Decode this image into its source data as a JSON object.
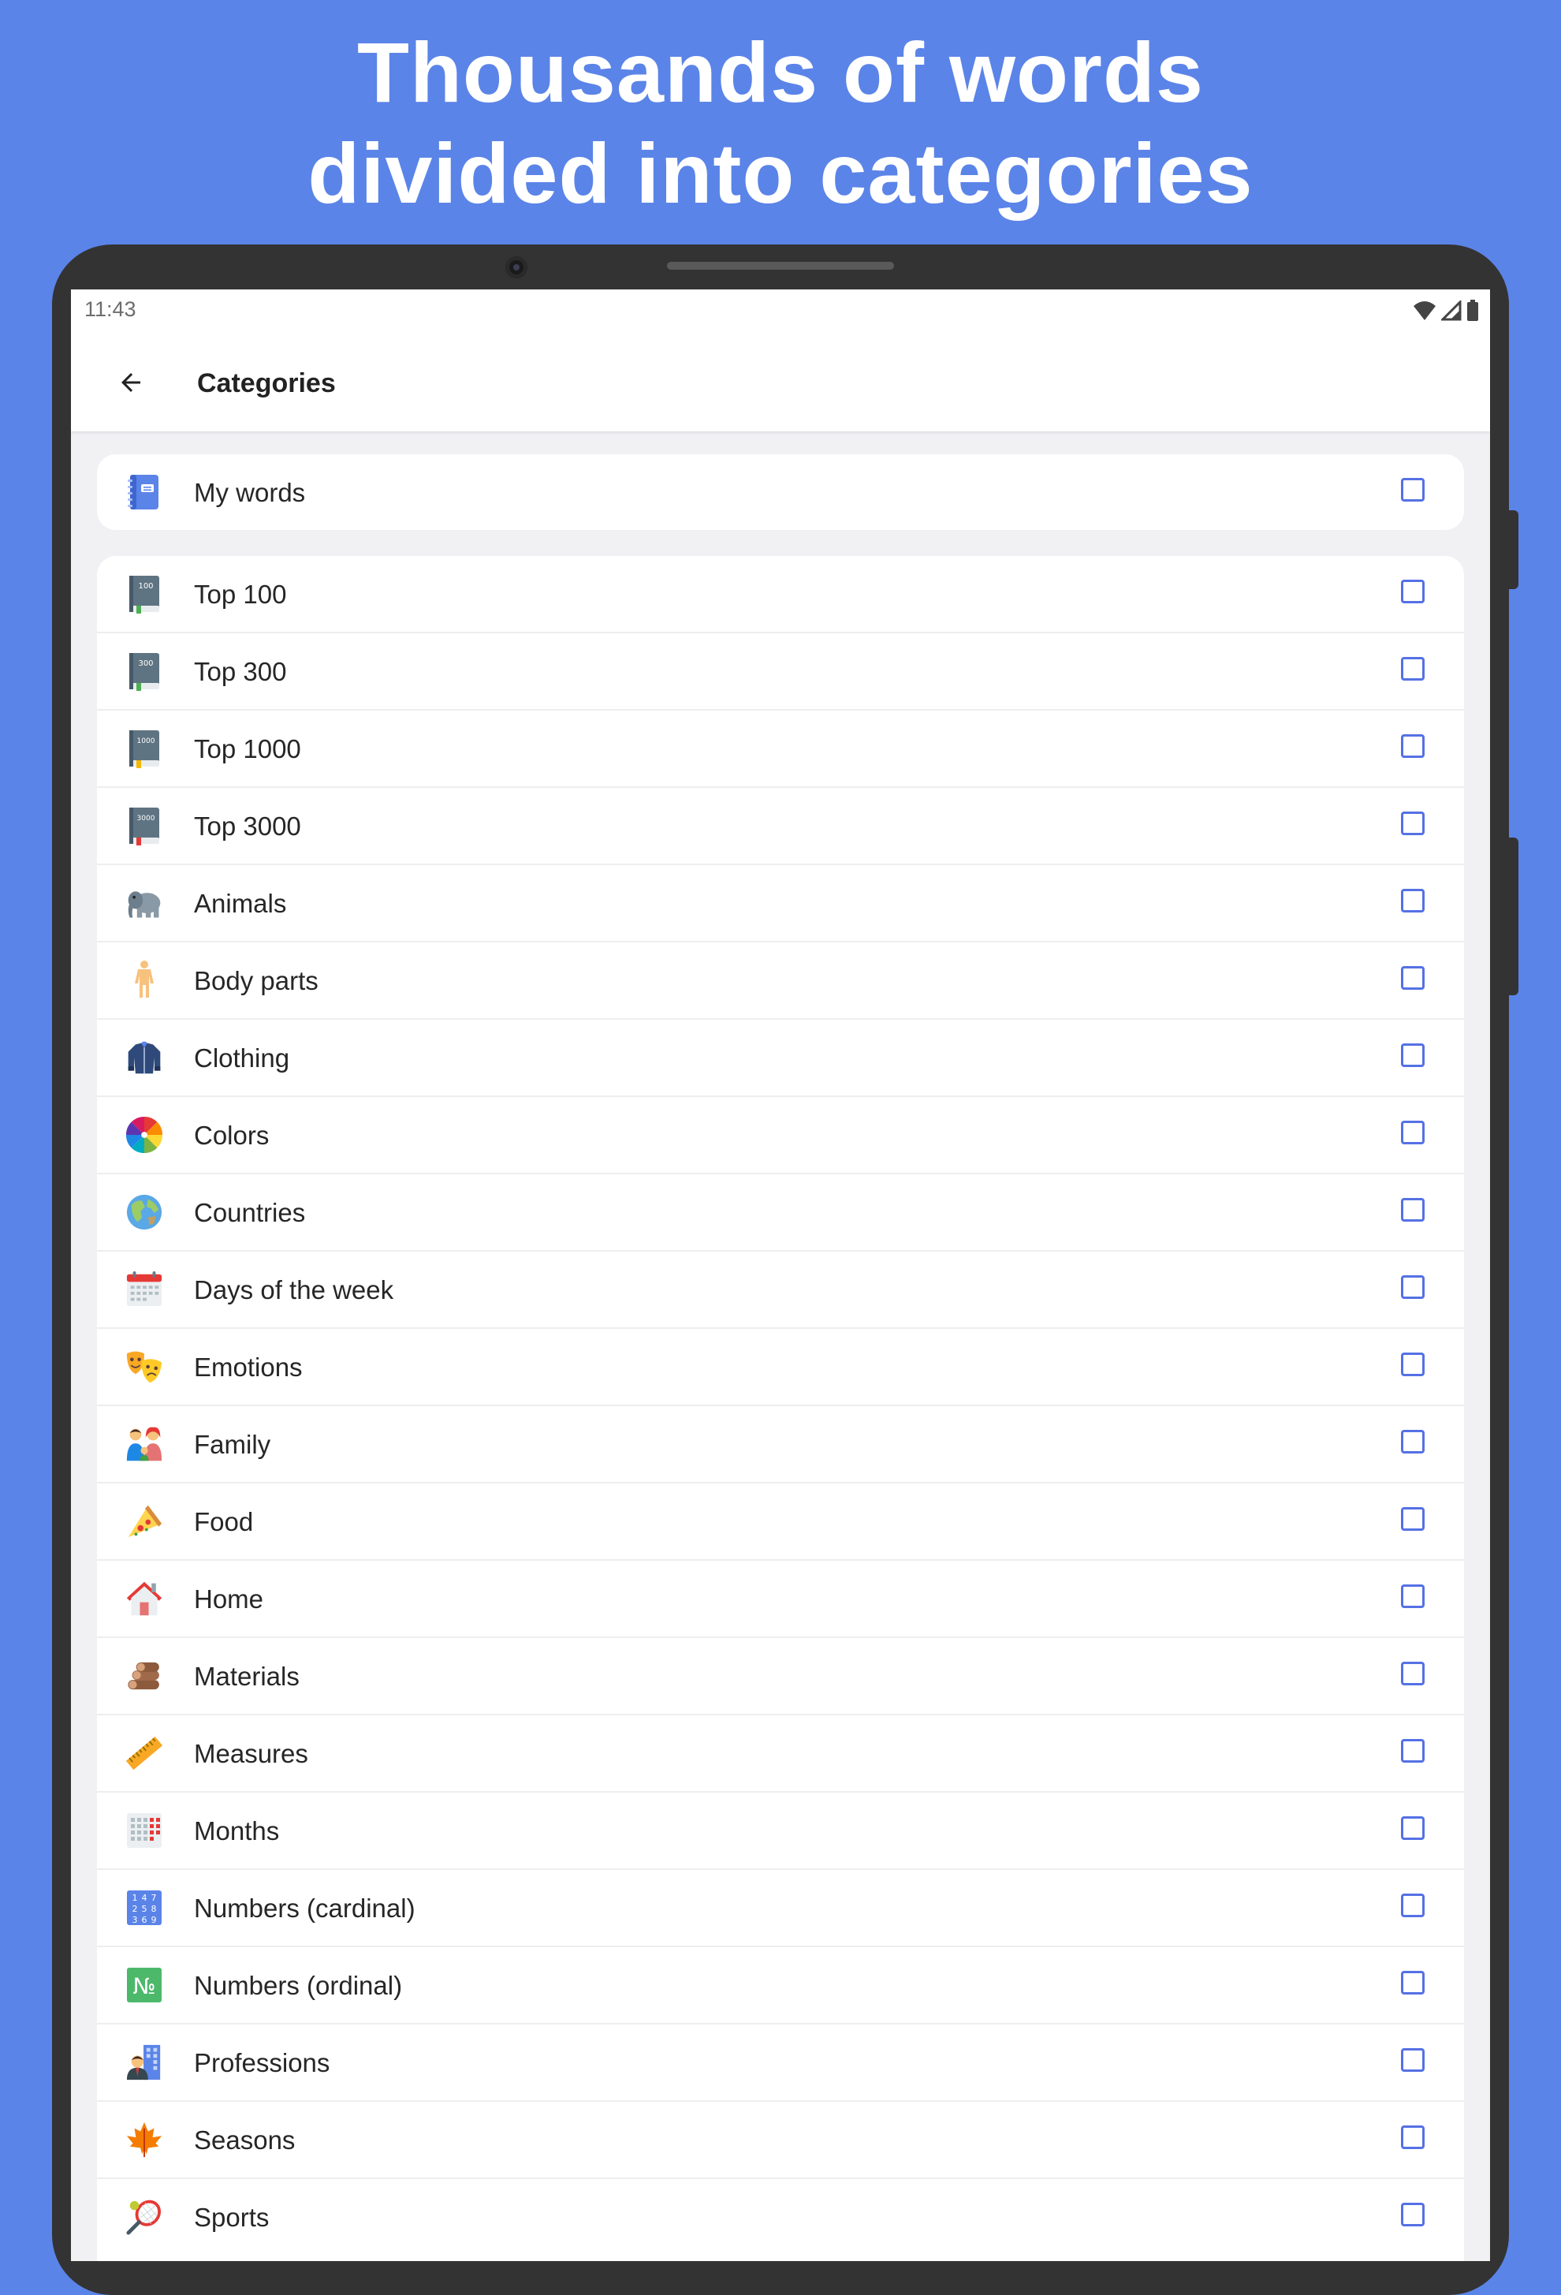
{
  "headline": {
    "line1": "Thousands of words",
    "line2": "divided into categories"
  },
  "status_bar": {
    "time": "11:43",
    "icons": [
      "wifi-icon",
      "signal-icon",
      "battery-icon"
    ]
  },
  "app_bar": {
    "back_icon": "arrow-left-icon",
    "title": "Categories"
  },
  "colors": {
    "background": "#5b84e8",
    "checkbox": "#5571e4",
    "device": "#333333"
  },
  "my_words": {
    "label": "My words",
    "icon": "notebook-icon",
    "checked": false
  },
  "categories": [
    {
      "label": "Top 100",
      "icon": "book-100-icon",
      "badge": "100",
      "checked": false
    },
    {
      "label": "Top 300",
      "icon": "book-300-icon",
      "badge": "300",
      "checked": false
    },
    {
      "label": "Top 1000",
      "icon": "book-1000-icon",
      "badge": "1000",
      "checked": false
    },
    {
      "label": "Top 3000",
      "icon": "book-3000-icon",
      "badge": "3000",
      "checked": false
    },
    {
      "label": "Animals",
      "icon": "elephant-icon",
      "checked": false
    },
    {
      "label": "Body parts",
      "icon": "human-body-icon",
      "checked": false
    },
    {
      "label": "Clothing",
      "icon": "jacket-icon",
      "checked": false
    },
    {
      "label": "Colors",
      "icon": "color-wheel-icon",
      "checked": false
    },
    {
      "label": "Countries",
      "icon": "globe-icon",
      "checked": false
    },
    {
      "label": "Days of the week",
      "icon": "calendar-icon",
      "checked": false
    },
    {
      "label": "Emotions",
      "icon": "theater-masks-icon",
      "checked": false
    },
    {
      "label": "Family",
      "icon": "family-icon",
      "checked": false
    },
    {
      "label": "Food",
      "icon": "pizza-icon",
      "checked": false
    },
    {
      "label": "Home",
      "icon": "house-icon",
      "checked": false
    },
    {
      "label": "Materials",
      "icon": "logs-icon",
      "checked": false
    },
    {
      "label": "Measures",
      "icon": "ruler-icon",
      "checked": false
    },
    {
      "label": "Months",
      "icon": "month-grid-icon",
      "checked": false
    },
    {
      "label": "Numbers (cardinal)",
      "icon": "number-pad-icon",
      "digits": "147258369",
      "checked": false
    },
    {
      "label": "Numbers (ordinal)",
      "icon": "numero-sign-icon",
      "glyph": "№",
      "checked": false
    },
    {
      "label": "Professions",
      "icon": "office-worker-icon",
      "checked": false
    },
    {
      "label": "Seasons",
      "icon": "maple-leaf-icon",
      "checked": false
    },
    {
      "label": "Sports",
      "icon": "tennis-racket-icon",
      "checked": false
    }
  ]
}
